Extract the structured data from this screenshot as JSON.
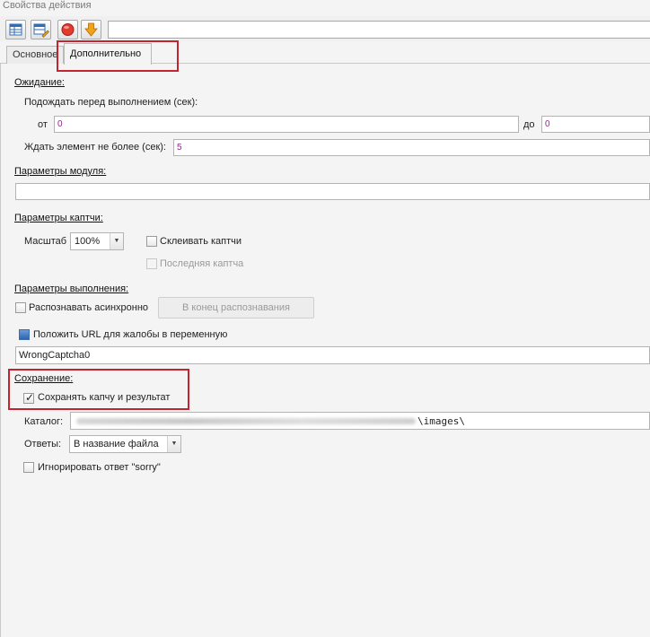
{
  "window": {
    "title": "Свойства действия"
  },
  "toolbar": {
    "buttons": [
      {
        "name": "table-icon",
        "color": "#2f6db5"
      },
      {
        "name": "table-edit-icon",
        "color": "#2f6db5"
      },
      {
        "name": "stop-icon",
        "color": "#e23b2e"
      },
      {
        "name": "arrow-down-icon",
        "color": "#f0a21a"
      }
    ],
    "input_value": ""
  },
  "tabs": [
    {
      "label": "Основное",
      "active": false
    },
    {
      "label": "Дополнительно",
      "active": true
    }
  ],
  "wait": {
    "section_label": "Ожидание:",
    "wait_before_label": "Подождать перед выполнением (сек):",
    "from_label": "от",
    "from_value": "0",
    "to_label": "до",
    "to_value": "0",
    "element_wait_label": "Ждать элемент не более (сек):",
    "element_wait_value": "5"
  },
  "module": {
    "section_label": "Параметры модуля:",
    "value": ""
  },
  "captcha": {
    "section_label": "Параметры каптчи:",
    "scale_label": "Масштаб",
    "scale_value": "100%",
    "glue_label": "Склеивать каптчи",
    "last_label": "Последняя каптча"
  },
  "execution": {
    "section_label": "Параметры выполнения:",
    "async_label": "Распознавать асинхронно",
    "end_button_label": "В конец распознавания",
    "url_label": "Положить URL для жалобы в переменную",
    "variable_value": "WrongCaptcha0"
  },
  "saving": {
    "section_label": "Сохранение:",
    "save_label": "Сохранять капчу и результат",
    "save_checked": true,
    "catalog_label": "Каталог:",
    "catalog_suffix": "\\images\\",
    "answers_label": "Ответы:",
    "answers_value": "В название файла",
    "ignore_sorry_label": "Игнорировать ответ \"sorry\""
  },
  "colors": {
    "highlight_box": "#c4232f",
    "number_text": "#8a2b8a"
  }
}
